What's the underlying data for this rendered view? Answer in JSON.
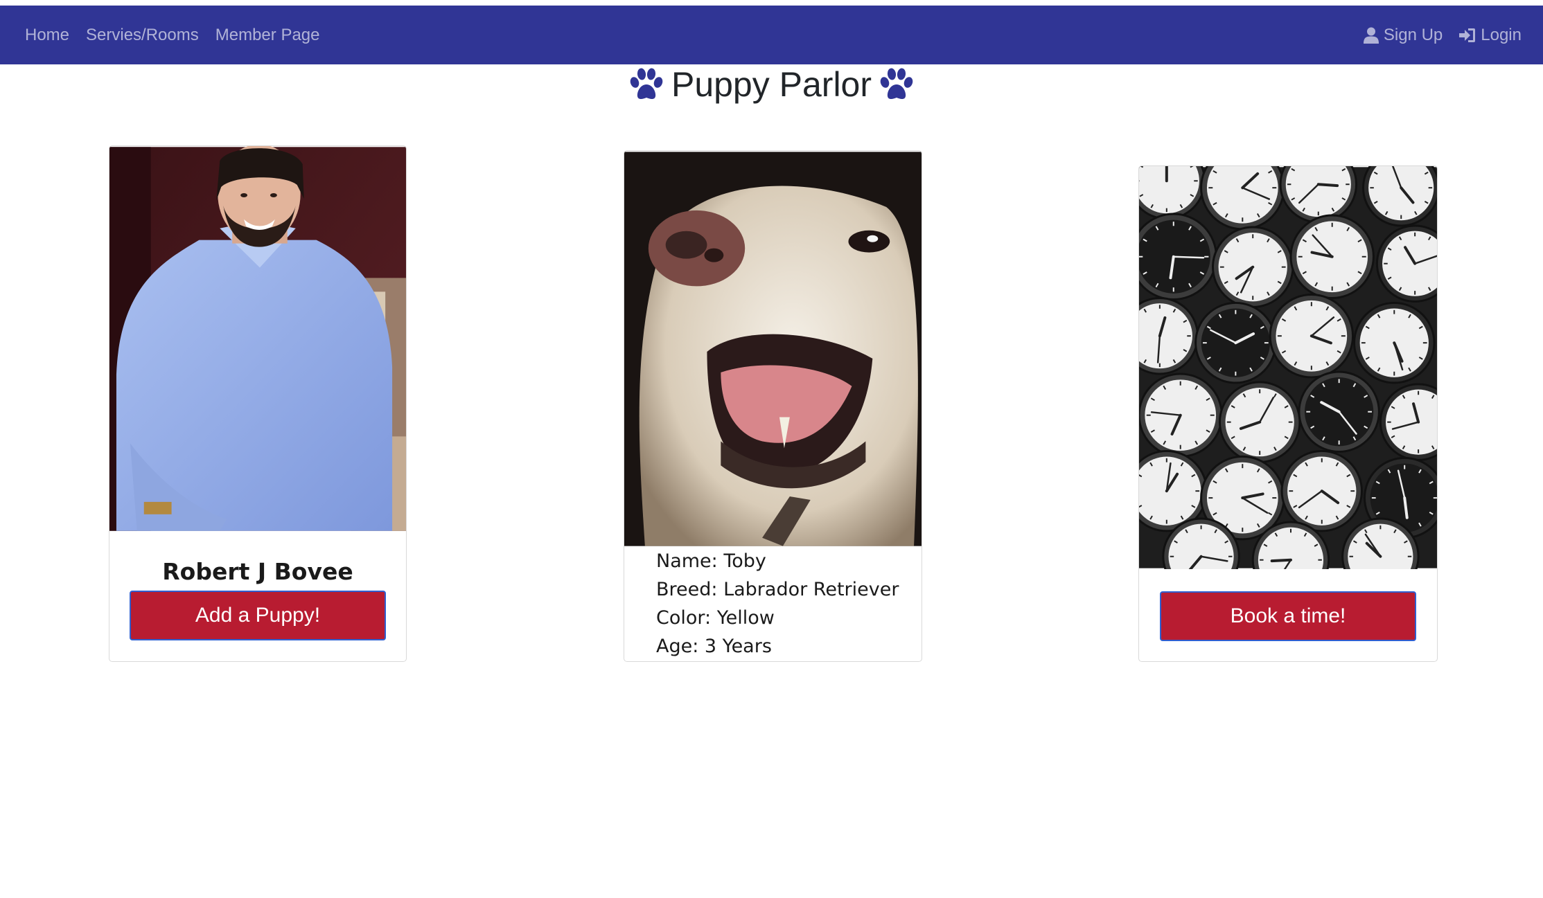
{
  "nav": {
    "home": "Home",
    "services": "Servies/Rooms",
    "member": "Member Page",
    "signup": "Sign Up",
    "login": "Login"
  },
  "brand": {
    "title": "Puppy Parlor",
    "color": "#303595"
  },
  "owner_card": {
    "name": "Robert J Bovee",
    "button": "Add a Puppy!"
  },
  "puppy_card": {
    "name": "Name: Toby",
    "breed": "Breed: Labrador Retriever",
    "color": "Color: Yellow",
    "age": "Age: 3 Years"
  },
  "booking_card": {
    "button": "Book a time!"
  },
  "colors": {
    "navbar": "#303595",
    "button": "#b81c31"
  }
}
